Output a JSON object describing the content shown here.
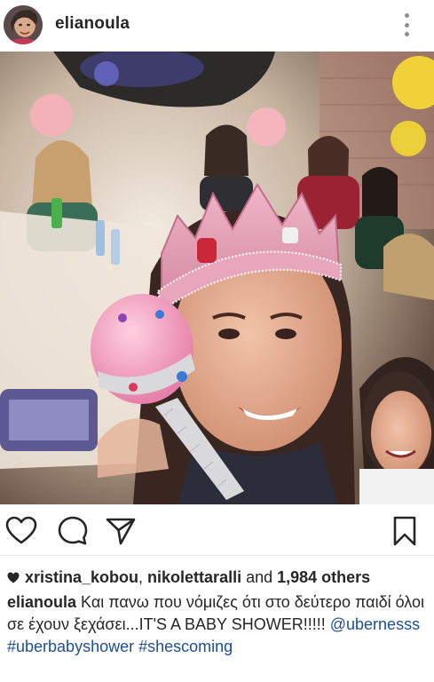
{
  "header": {
    "username": "elianoula",
    "avatar_icon": "user-avatar",
    "more_icon": "more-vertical-icon"
  },
  "photo": {
    "alt_icon": "post-photo"
  },
  "actions": {
    "like_icon": "heart-outline-icon",
    "comment_icon": "comment-bubble-icon",
    "share_icon": "paper-plane-icon",
    "save_icon": "bookmark-icon"
  },
  "likes": {
    "user1": "xristina_kobou",
    "separator": ", ",
    "user2": "nikolettaralli",
    "and_text": " and ",
    "others_count": "1,984 others"
  },
  "caption": {
    "author": "elianoula",
    "text": " Και πανω που νόμιζες ότι στο δεύτερο παιδί όλοι σε έχουν ξεχάσει...IT'S A BABY SHOWER!!!!! ",
    "mention": "@ubernesss",
    "hashtag1": "#uberbabyshower",
    "hashtag2": "#shescoming"
  },
  "colors": {
    "text": "#262626",
    "link": "#1d4f91",
    "icon": "#262626",
    "secondary": "#8e8e8e"
  }
}
